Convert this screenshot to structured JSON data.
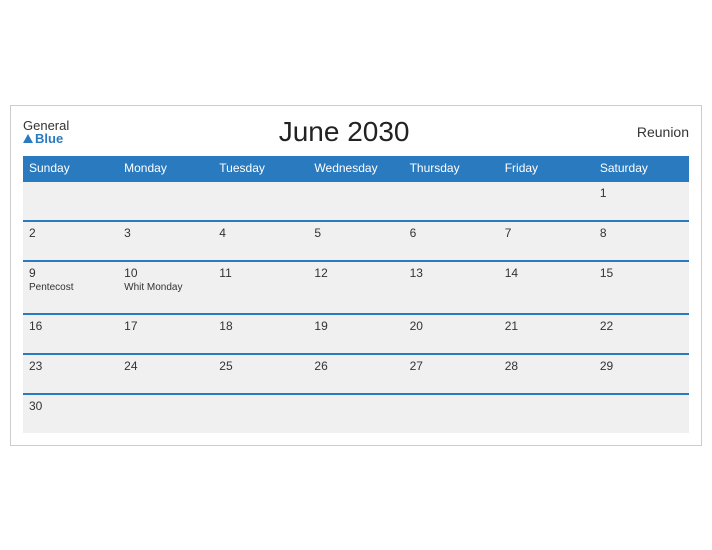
{
  "header": {
    "title": "June 2030",
    "region": "Reunion",
    "logo_general": "General",
    "logo_blue": "Blue"
  },
  "columns": [
    "Sunday",
    "Monday",
    "Tuesday",
    "Wednesday",
    "Thursday",
    "Friday",
    "Saturday"
  ],
  "weeks": [
    [
      {
        "day": "",
        "event": ""
      },
      {
        "day": "",
        "event": ""
      },
      {
        "day": "",
        "event": ""
      },
      {
        "day": "",
        "event": ""
      },
      {
        "day": "",
        "event": ""
      },
      {
        "day": "",
        "event": ""
      },
      {
        "day": "1",
        "event": ""
      }
    ],
    [
      {
        "day": "2",
        "event": ""
      },
      {
        "day": "3",
        "event": ""
      },
      {
        "day": "4",
        "event": ""
      },
      {
        "day": "5",
        "event": ""
      },
      {
        "day": "6",
        "event": ""
      },
      {
        "day": "7",
        "event": ""
      },
      {
        "day": "8",
        "event": ""
      }
    ],
    [
      {
        "day": "9",
        "event": "Pentecost"
      },
      {
        "day": "10",
        "event": "Whit Monday"
      },
      {
        "day": "11",
        "event": ""
      },
      {
        "day": "12",
        "event": ""
      },
      {
        "day": "13",
        "event": ""
      },
      {
        "day": "14",
        "event": ""
      },
      {
        "day": "15",
        "event": ""
      }
    ],
    [
      {
        "day": "16",
        "event": ""
      },
      {
        "day": "17",
        "event": ""
      },
      {
        "day": "18",
        "event": ""
      },
      {
        "day": "19",
        "event": ""
      },
      {
        "day": "20",
        "event": ""
      },
      {
        "day": "21",
        "event": ""
      },
      {
        "day": "22",
        "event": ""
      }
    ],
    [
      {
        "day": "23",
        "event": ""
      },
      {
        "day": "24",
        "event": ""
      },
      {
        "day": "25",
        "event": ""
      },
      {
        "day": "26",
        "event": ""
      },
      {
        "day": "27",
        "event": ""
      },
      {
        "day": "28",
        "event": ""
      },
      {
        "day": "29",
        "event": ""
      }
    ],
    [
      {
        "day": "30",
        "event": ""
      },
      {
        "day": "",
        "event": ""
      },
      {
        "day": "",
        "event": ""
      },
      {
        "day": "",
        "event": ""
      },
      {
        "day": "",
        "event": ""
      },
      {
        "day": "",
        "event": ""
      },
      {
        "day": "",
        "event": ""
      }
    ]
  ]
}
